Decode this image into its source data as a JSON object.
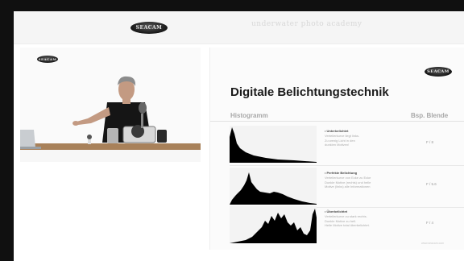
{
  "header": {
    "logo_text": "SEACAM",
    "tagline": "underwater photo academy"
  },
  "video": {
    "logo_text": "SEACAM"
  },
  "slide": {
    "logo_text": "SEACAM",
    "title": "Digitale Belichtungstechnik",
    "col_left": "Histogramm",
    "col_right": "Bsp. Blende",
    "rows": [
      {
        "title": "• Unterbelichtet",
        "desc": [
          "Verteilerkurve liegt links.",
          "Zu wenig Licht in den",
          "dunklen Motiven!"
        ],
        "aperture": "F / 8"
      },
      {
        "title": "• Perfekte Belichtung",
        "desc": [
          "Verteilerkurve von Ecke zu Ecke",
          "Dunkle Motive (rechts) und helle",
          "Motive (links) alle Informationen"
        ],
        "aperture": "F / 5.6"
      },
      {
        "title": "• Überbelichtet",
        "desc": [
          "Verteilerkurve zu stark rechts.",
          "Dunkle Motive zu hell.",
          "Helle Motive total überbelichtet."
        ],
        "aperture": "F / 4"
      }
    ],
    "footer": "www.seacam.com"
  }
}
